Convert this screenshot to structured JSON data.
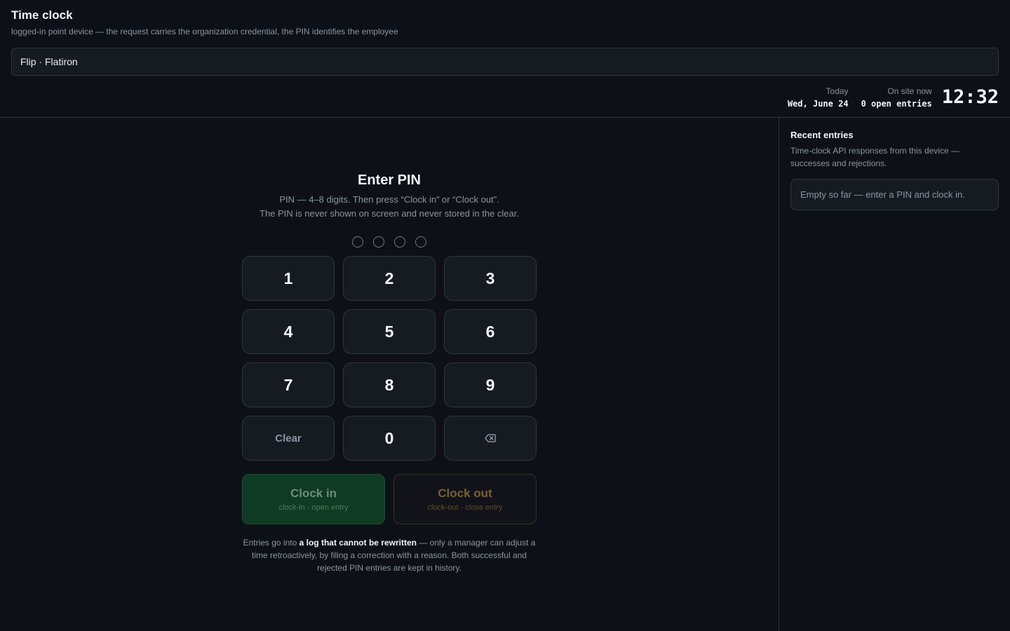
{
  "header": {
    "title": "Time clock",
    "subtitle": "logged-in point device — the request carries the organization credential, the PIN identifies the employee",
    "location": "Flip · Flatiron"
  },
  "stats": {
    "today_label": "Today",
    "today_value": "Wed, June 24",
    "onsite_label": "On site now",
    "onsite_value": "0 open entries",
    "clock": "12:32"
  },
  "pin": {
    "title": "Enter PIN",
    "help_line1": "PIN — 4–8 digits. Then press “Clock in” or “Clock out”.",
    "help_line2": "The PIN is never shown on screen and never stored in the clear.",
    "dots_filled": 0,
    "dots_total": 4
  },
  "keypad": {
    "keys": [
      "1",
      "2",
      "3",
      "4",
      "5",
      "6",
      "7",
      "8",
      "9"
    ],
    "clear_label": "Clear",
    "zero_label": "0",
    "backspace_icon": "backspace-icon"
  },
  "actions": {
    "clock_in_label": "Clock in",
    "clock_in_sub": "clock-in · open entry",
    "clock_out_label": "Clock out",
    "clock_out_sub": "clock-out · close entry"
  },
  "note": {
    "part1": "Entries go into ",
    "bold": "a log that cannot be rewritten",
    "part2": " — only a manager can adjust a time retroactively, by filing a correction with a reason. Both successful and rejected PIN entries are kept in history."
  },
  "recent": {
    "title": "Recent entries",
    "description": "Time-clock API responses from this device — successes and rejections.",
    "empty": "Empty so far — enter a PIN and clock in."
  },
  "colors": {
    "background": "#0d1117",
    "clock_in_bg": "#0f3b24",
    "clock_out_border": "#3a3020"
  }
}
